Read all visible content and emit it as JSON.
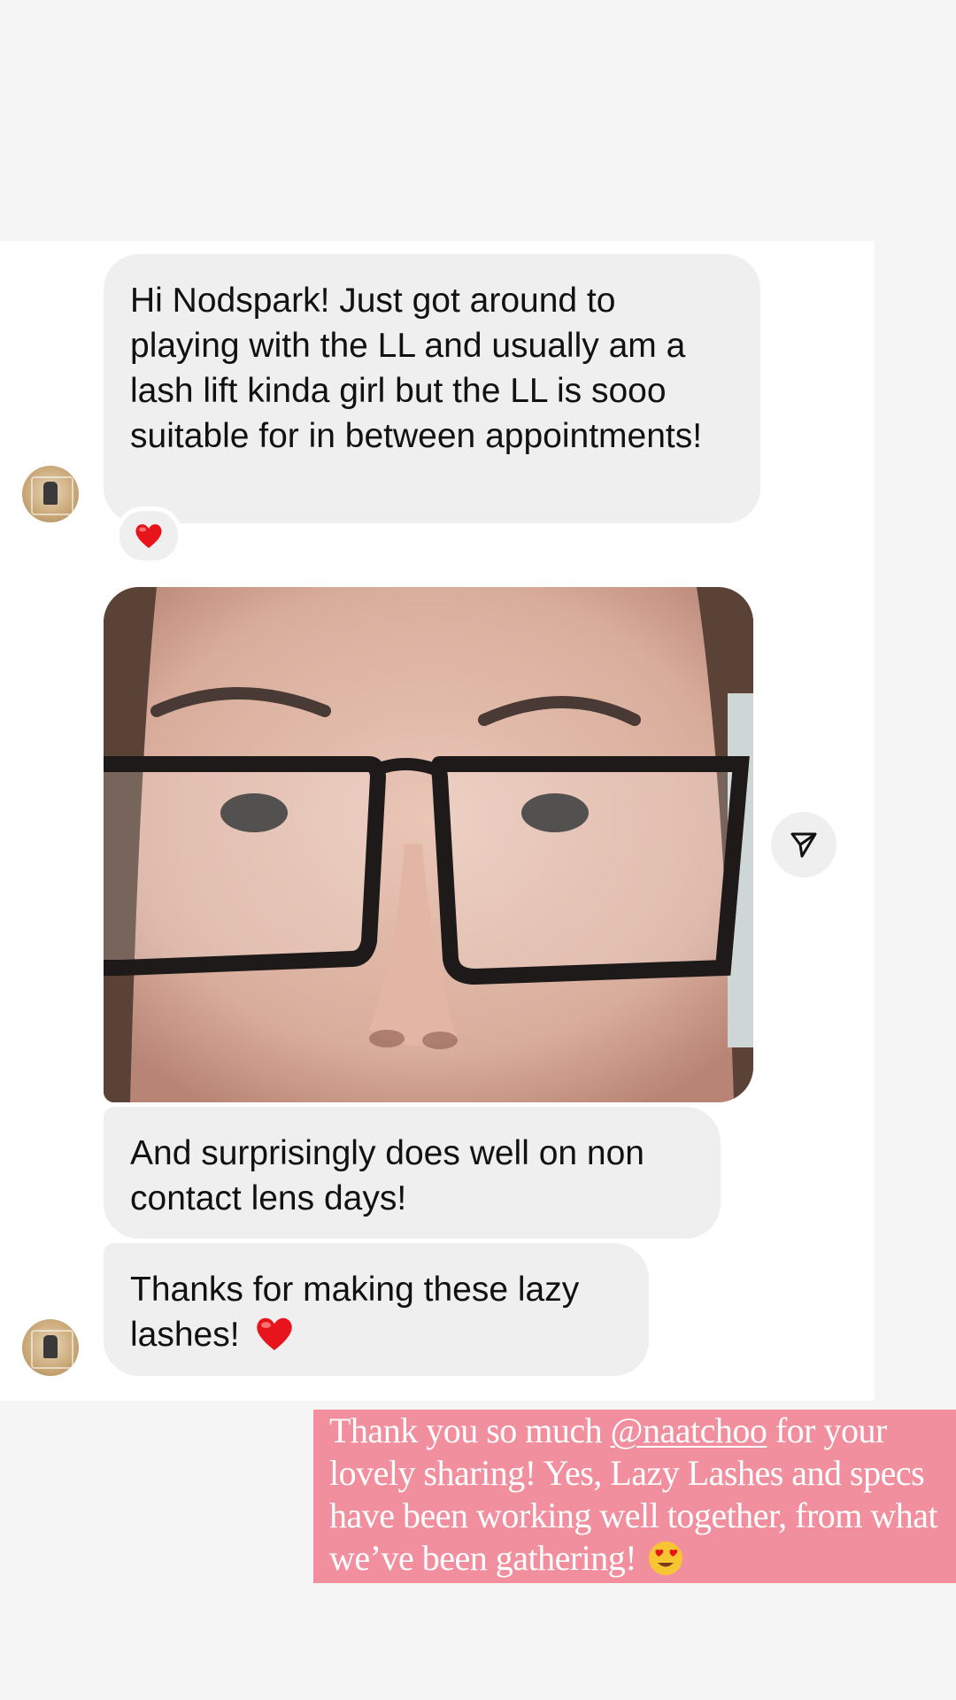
{
  "chat": {
    "messages": [
      {
        "text": "Hi Nodspark! Just got around to playing with the LL and usually am a lash lift kinda girl but the LL is sooo suitable for in between appointments!",
        "reaction": "heart-emoji"
      },
      {
        "type": "photo",
        "description_icon": "selfie-photo"
      },
      {
        "text": "And surprisingly does well on non contact lens days!"
      },
      {
        "text": "Thanks for making these lazy lashes!",
        "trailing_emoji": "heart-emoji"
      }
    ]
  },
  "caption": {
    "before": "Thank you so much ",
    "mention": "@naatchoo",
    "after": " for your lovely sharing! Yes, Lazy Lashes and specs have been working well together, from what we’ve been gathering!",
    "trailing_emoji": "heart-eyes-emoji"
  },
  "colors": {
    "page_bg": "#f5f5f5",
    "bubble_bg": "#efefef",
    "caption_bg": "#f28f9e",
    "heart": "#e8141c"
  }
}
